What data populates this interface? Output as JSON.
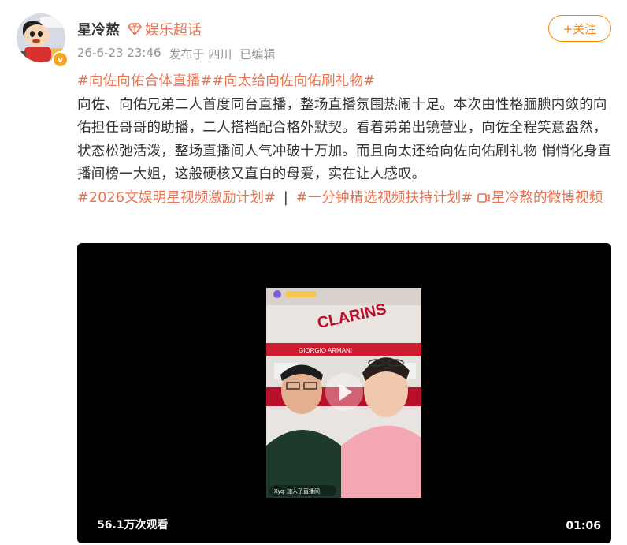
{
  "post": {
    "author": "星冷熬",
    "super_topic": "娱乐超话",
    "timestamp": "26-6-23 23:46",
    "location": "发布于 四川",
    "edited": "已编辑",
    "follow_label": "+关注"
  },
  "content": {
    "hashtag_1": "#向佐向佑合体直播#",
    "hashtag_2": "#向太给向佐向佑刷礼物#",
    "body": "向佐、向佑兄弟二人首度同台直播，整场直播氛围热闹十足。本次由性格腼腆内敛的向佑担任哥哥的助播，二人搭档配合格外默契。看着弟弟出镜营业，向佐全程笑意盎然，状态松弛活泼，整场直播间人气冲破十万加。而且向太还给向佐向佑刷礼物 悄悄化身直播间榜一大姐，这般硬核又直白的母爱，实在让人感叹。",
    "tag_a": "#2026文娱明星视频激励计划#",
    "separator": "|",
    "tag_b": "#一分钟精选视频扶持计划#",
    "video_link": "星冷熬的微博视频"
  },
  "video": {
    "views": "56.1万次观看",
    "duration": "01:06",
    "frame_store_sign": "CLARINS",
    "frame_store_sign_2": "GIORGIO ARMANI",
    "frame_comment": "Xyq: 加入了直播间"
  },
  "colors": {
    "accent": "#eb7350",
    "follow": "#ff8200",
    "verified": "#f6a623"
  }
}
